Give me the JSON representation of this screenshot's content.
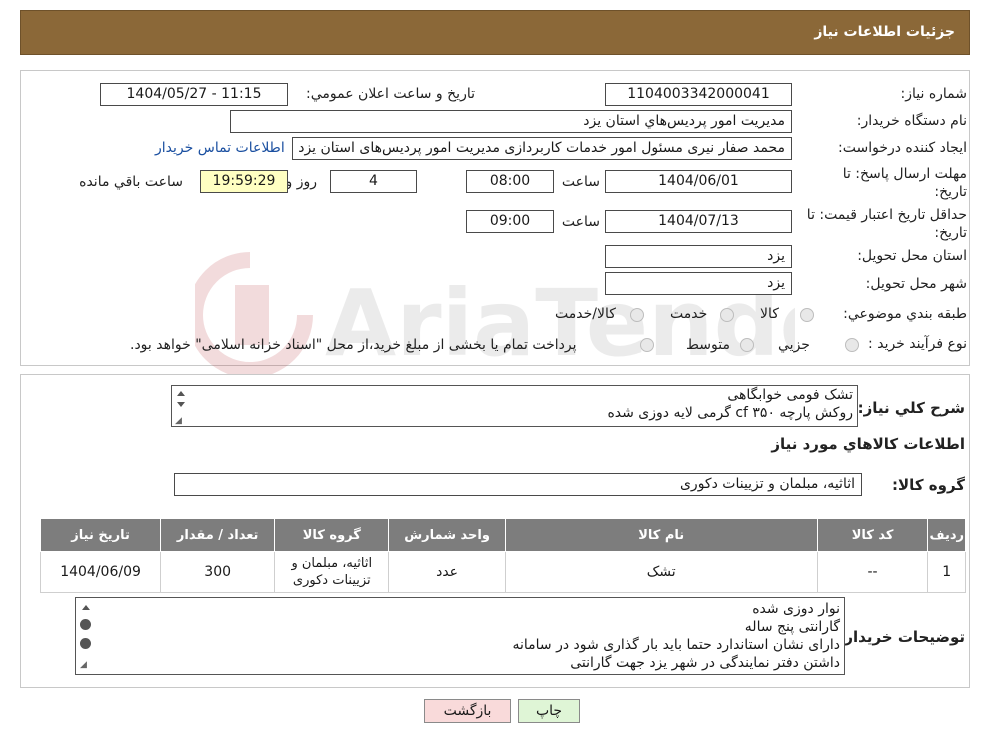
{
  "header": {
    "title": "جزئیات اطلاعات نیاز"
  },
  "form": {
    "need_number_label": "شماره نیاز:",
    "need_number": "1104003342000041",
    "announce_label": "تاريخ و ساعت اعلان عمومي:",
    "announce_value": "1404/05/27 - 11:15",
    "buyer_org_label": "نام دستگاه خريدار:",
    "buyer_org": "مديريت امور پرديس‌هاي استان يزد",
    "creator_label": "ايجاد كننده درخواست:",
    "creator": "محمد  صفار نيرى مسئول امور خدمات كاربردازى مديريت امور پرديس‌هاى استان يزد",
    "contact_link": "اطلاعات تماس خريدار",
    "deadline_label": "مهلت ارسال پاسخ: تا تاريخ:",
    "deadline_date": "1404/06/01",
    "time_label": "ساعت",
    "deadline_time": "08:00",
    "days_value": "4",
    "days_label": "روز و",
    "remaining_time": "19:59:29",
    "remaining_label": "ساعت باقي مانده",
    "validity_label": "حداقل تاريخ اعتبار قيمت: تا تاريخ:",
    "validity_date": "1404/07/13",
    "validity_time": "09:00",
    "province_label": "استان محل تحويل:",
    "province": "يزد",
    "city_label": "شهر محل تحويل:",
    "city": "يزد",
    "category_label": "طبقه بندي موضوعي:",
    "category_options": [
      "كالا",
      "خدمت",
      "كالا/خدمت"
    ],
    "process_label": "نوع فرآيند خريد :",
    "process_options": [
      "جزيي",
      "متوسط"
    ],
    "process_note": "پرداخت تمام يا بخشى از مبلغ خريد،از محل \"اسناد خزانه اسلامى\" خواهد بود."
  },
  "description": {
    "label": "شرح كلي نياز:",
    "lines": [
      "تشک فومی خوابگاهی",
      "روکش پارچه ۳۵۰ cf گرمی لایه دوزی شده"
    ]
  },
  "goods": {
    "section_title": "اطلاعات كالاهاي مورد نياز",
    "group_label": "گروه كالا:",
    "group_value": "اثاثيه، مبلمان و تزيينات دكورى",
    "columns": [
      "رديف",
      "كد كالا",
      "نام كالا",
      "واحد شمارش",
      "گروه كالا",
      "تعداد / مقدار",
      "تاريخ نياز"
    ],
    "rows": [
      {
        "row": "1",
        "code": "--",
        "name": "تشک",
        "unit": "عدد",
        "group_line1": "اثاثيه، مبلمان و",
        "group_line2": "تزيينات دكورى",
        "qty": "300",
        "date": "1404/06/09"
      }
    ]
  },
  "buyer_notes": {
    "label": "توضيحات خريدار:",
    "lines": [
      "نوار دوزی شده",
      "گارانتی پنج ساله",
      "دارای نشان استاندارد  حتما باید بار گذاری شود در سامانه",
      "داشتن دفتر نمایندگی در شهر یزد جهت گارانتی"
    ]
  },
  "buttons": {
    "print": "چاپ",
    "back": "بازگشت"
  },
  "colors": {
    "header": "#8b6838",
    "print_btn": "#dff5d6",
    "back_btn": "#f9dada",
    "table_header": "#7d7d7d"
  }
}
